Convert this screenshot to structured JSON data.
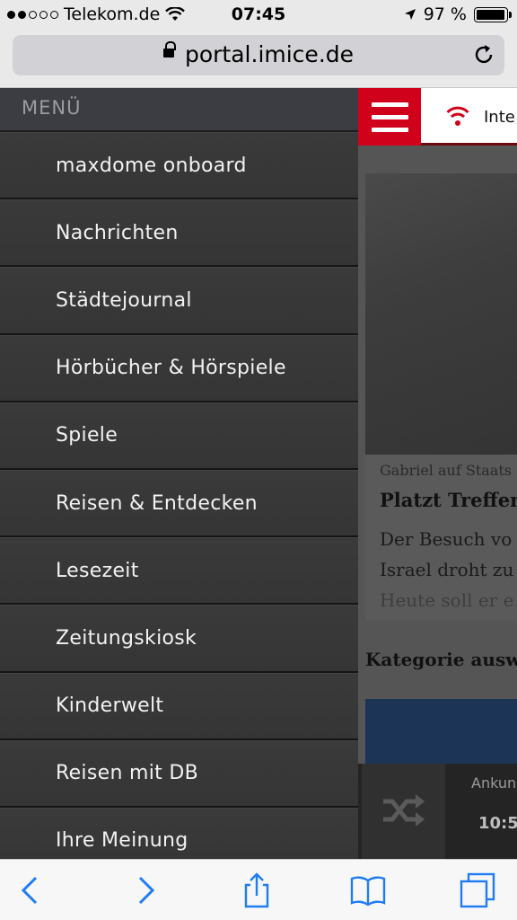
{
  "status_bar": {
    "carrier": "Telekom.de",
    "time": "07:45",
    "battery_percent": "97 %",
    "battery_level": 0.97
  },
  "browser": {
    "url": "portal.imice.de"
  },
  "menu": {
    "header": "MENÜ",
    "items": [
      {
        "label": "maxdome onboard"
      },
      {
        "label": "Nachrichten"
      },
      {
        "label": "Städtejournal"
      },
      {
        "label": "Hörbücher & Hörspiele"
      },
      {
        "label": "Spiele"
      },
      {
        "label": "Reisen & Entdecken"
      },
      {
        "label": "Lesezeit"
      },
      {
        "label": "Zeitungskiosk"
      },
      {
        "label": "Kinderwelt"
      },
      {
        "label": "Reisen mit DB"
      },
      {
        "label": "Ihre Meinung"
      }
    ]
  },
  "page": {
    "header_text": "Inte",
    "article": {
      "kicker": "Gabriel auf Staats",
      "headline": "Platzt Treffen",
      "teaser_line1": "Der Besuch vo",
      "teaser_line2": "Israel droht zu",
      "teaser_line3": "Heute soll er e"
    },
    "category_heading": "Kategorie ausw",
    "arrival_label": "Ankun",
    "arrival_time": "10:5"
  },
  "colors": {
    "brand_red": "#d0021b",
    "menu_bg": "#2e2e2e",
    "ios_blue": "#1f7cf5"
  }
}
